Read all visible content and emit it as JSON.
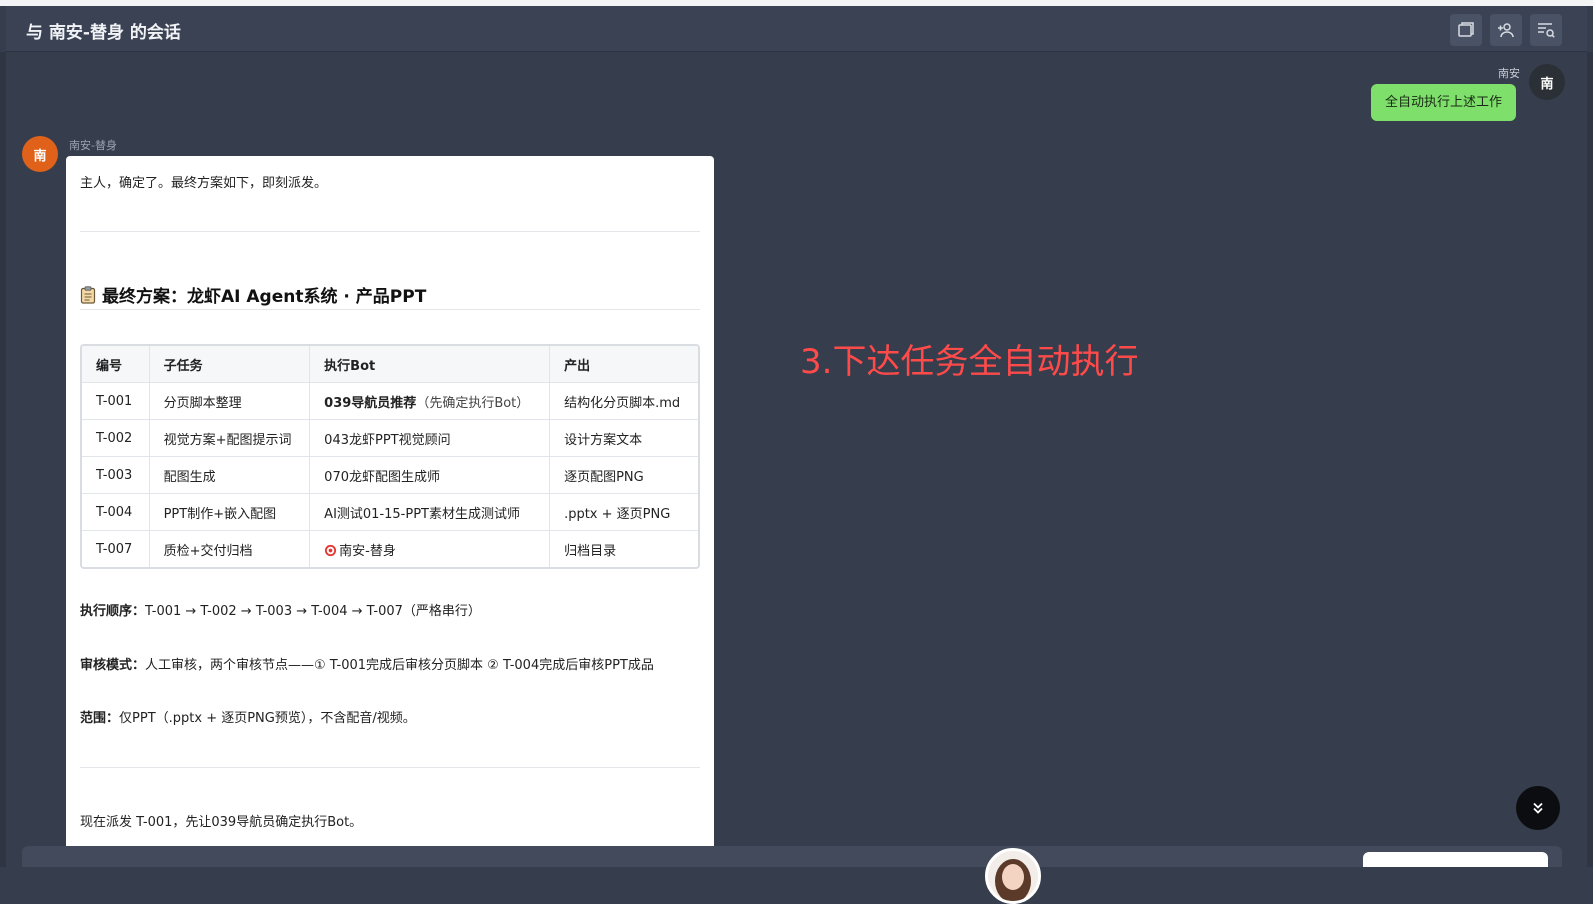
{
  "header": {
    "title": "与 南安-替身 的会话",
    "actions": [
      {
        "name": "window-icon"
      },
      {
        "name": "add-member-icon"
      },
      {
        "name": "search-history-icon"
      }
    ]
  },
  "user_message": {
    "sender": "南安",
    "avatar_text": "南",
    "text": "全自动执行上述工作",
    "bubble_color": "#7ee06a"
  },
  "bot_message": {
    "sender": "南安-替身",
    "avatar_text": "南",
    "avatar_color": "#e0621a",
    "intro": "主人，确定了。最终方案如下，即刻派发。",
    "heading": "最终方案：龙虾AI Agent系统 · 产品PPT",
    "table": {
      "headers": [
        "编号",
        "子任务",
        "执行Bot",
        "产出"
      ],
      "rows": [
        [
          "T-001",
          "分页脚本整理",
          "039导航员推荐",
          "（先确定执行Bot）",
          "结构化分页脚本.md"
        ],
        [
          "T-002",
          "视觉方案+配图提示词",
          "043龙虾PPT视觉顾问",
          "",
          "设计方案文本"
        ],
        [
          "T-003",
          "配图生成",
          "070龙虾配图生成师",
          "",
          "逐页配图PNG"
        ],
        [
          "T-004",
          "PPT制作+嵌入配图",
          "AI测试01-15-PPT素材生成测试师",
          "",
          ".pptx + 逐页PNG"
        ],
        [
          "T-007",
          "质检+交付归档",
          "南安-替身",
          "",
          "归档目录"
        ]
      ]
    },
    "order_label": "执行顺序：",
    "order_text": "T-001 → T-002 → T-003 → T-004 → T-007（严格串行）",
    "review_label": "审核模式：",
    "review_text": "人工审核，两个审核节点——① T-001完成后审核分页脚本 ② T-004完成后审核PPT成品",
    "scope_label": "范围：",
    "scope_text": "仅PPT（.pptx + 逐页PNG预览），不含配音/视频。",
    "closing": "现在派发 T-001，先让039导航员确定执行Bot。"
  },
  "annotation": {
    "text": "3.下达任务全自动执行",
    "color": "#ff4a4a"
  },
  "scroll_button": {
    "icon": "double-chevron-down-icon"
  }
}
